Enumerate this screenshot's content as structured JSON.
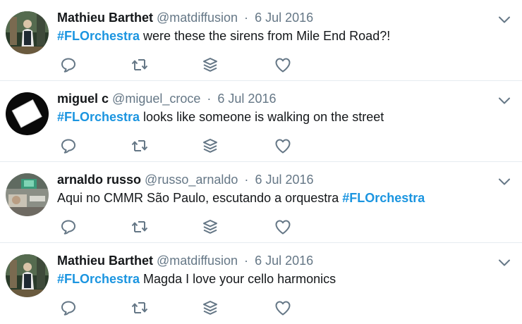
{
  "tweets": [
    {
      "name": "Mathieu Barthet",
      "handle": "@matdiffusion",
      "separator": "·",
      "date": "6 Jul 2016",
      "hashtag": "#FLOrchestra",
      "text": " were these the sirens from Mile End Road?!",
      "avatar": "person-photo"
    },
    {
      "name": "miguel c",
      "handle": "@miguel_croce",
      "separator": "·",
      "date": "6 Jul 2016",
      "hashtag": "#FLOrchestra",
      "text": " looks like someone is walking on the street",
      "avatar": "white-square-on-black"
    },
    {
      "name": "arnaldo russo",
      "handle": "@russo_arnaldo",
      "separator": "·",
      "date": "6 Jul 2016",
      "text_before": "Aqui no CMMR São Paulo, escutando a orquestra ",
      "hashtag": "#FLOrchestra",
      "avatar": "desk-photo"
    },
    {
      "name": "Mathieu Barthet",
      "handle": "@matdiffusion",
      "separator": "·",
      "date": "6 Jul 2016",
      "hashtag": "#FLOrchestra",
      "text": " Magda I love your cello harmonics",
      "avatar": "person-photo"
    }
  ],
  "icons": {
    "reply": "reply-icon",
    "retweet": "retweet-icon",
    "stack": "stack-icon",
    "like": "heart-icon",
    "menu": "chevron-down-icon"
  },
  "colors": {
    "hashtag": "#1b95e0",
    "meta": "#657786",
    "icon": "#657786",
    "divider": "#e6ecf0"
  }
}
